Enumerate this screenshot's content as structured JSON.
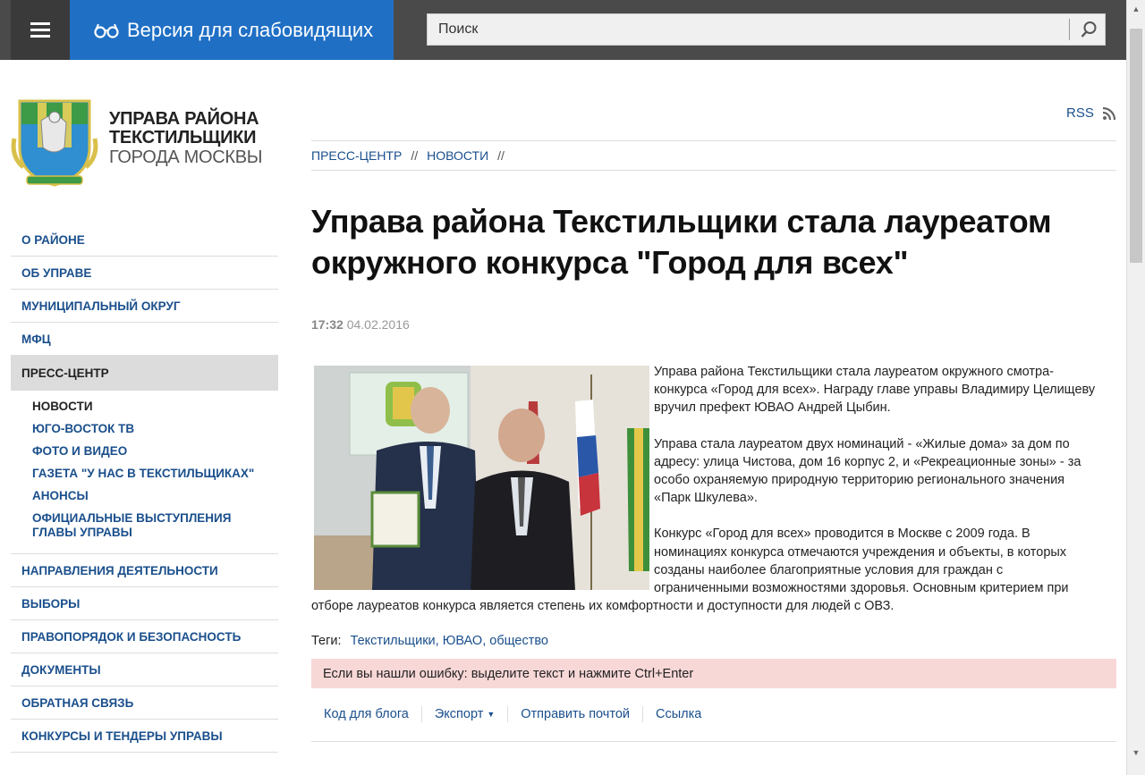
{
  "header": {
    "vision_label": "Версия для слабовидящих",
    "search_placeholder": "Поиск"
  },
  "logo": {
    "line1": "УПРАВА РАЙОНА",
    "line2": "ТЕКСТИЛЬЩИКИ",
    "line3": "ГОРОДА МОСКВЫ"
  },
  "sidebar": {
    "items_top": [
      {
        "label": "О РАЙОНЕ"
      },
      {
        "label": "ОБ УПРАВЕ"
      },
      {
        "label": "МУНИЦИПАЛЬНЫЙ ОКРУГ"
      },
      {
        "label": "МФЦ"
      }
    ],
    "active": "ПРЕСС-ЦЕНТР",
    "subitems": [
      {
        "label": "НОВОСТИ"
      },
      {
        "label": "ЮГО-ВОСТОК ТВ"
      },
      {
        "label": "ФОТО И ВИДЕО"
      },
      {
        "label": "ГАЗЕТА \"У НАС В ТЕКСТИЛЬЩИКАХ\""
      },
      {
        "label": "АНОНСЫ"
      },
      {
        "label": "ОФИЦИАЛЬНЫЕ ВЫСТУПЛЕНИЯ ГЛАВЫ УПРАВЫ"
      }
    ],
    "items_bottom": [
      {
        "label": "НАПРАВЛЕНИЯ ДЕЯТЕЛЬНОСТИ"
      },
      {
        "label": "ВЫБОРЫ"
      },
      {
        "label": "ПРАВОПОРЯДОК И БЕЗОПАСНОСТЬ"
      },
      {
        "label": "ДОКУМЕНТЫ"
      },
      {
        "label": "ОБРАТНАЯ СВЯЗЬ"
      },
      {
        "label": "КОНКУРСЫ И ТЕНДЕРЫ УПРАВЫ"
      }
    ]
  },
  "main": {
    "rss": "RSS",
    "breadcrumb": [
      "ПРЕСС-ЦЕНТР",
      "НОВОСТИ"
    ],
    "breadcrumb_sep": "//",
    "title": "Управа района Текстильщики стала лауреатом окружного конкурса \"Город для всех\"",
    "time": "17:32",
    "date": "04.02.2016",
    "paragraphs": [
      "Управа района Текстильщики стала лауреатом окружного смотра-конкурса «Город для всех». Награду главе управы Владимиру Целищеву вручил префект ЮВАО Андрей Цыбин.",
      "Управа стала лауреатом двух номинаций - «Жилые дома» за дом по адресу: улица Чистова, дом 16 корпус 2, и «Рекреационные зоны» - за особо охраняемую природную территорию регионального значения «Парк Шкулева».",
      "Конкурс «Город для всех» проводится в Москве с 2009 года. В номинациях конкурса отмечаются учреждения и объекты, в которых созданы наиболее благоприятные условия для граждан с ограниченными возможностями здоровья. Основным критерием при отборе лауреатов конкурса является степень их комфортности и доступности для людей с ОВЗ."
    ],
    "tags_label": "Теги:",
    "tags": [
      "Текстильщики",
      "ЮВАО",
      "общество"
    ],
    "error_notice": "Если вы нашли ошибку: выделите текст и нажмите Ctrl+Enter",
    "share": {
      "blog": "Код для блога",
      "export": "Экспорт",
      "email": "Отправить почтой",
      "link": "Ссылка"
    }
  }
}
